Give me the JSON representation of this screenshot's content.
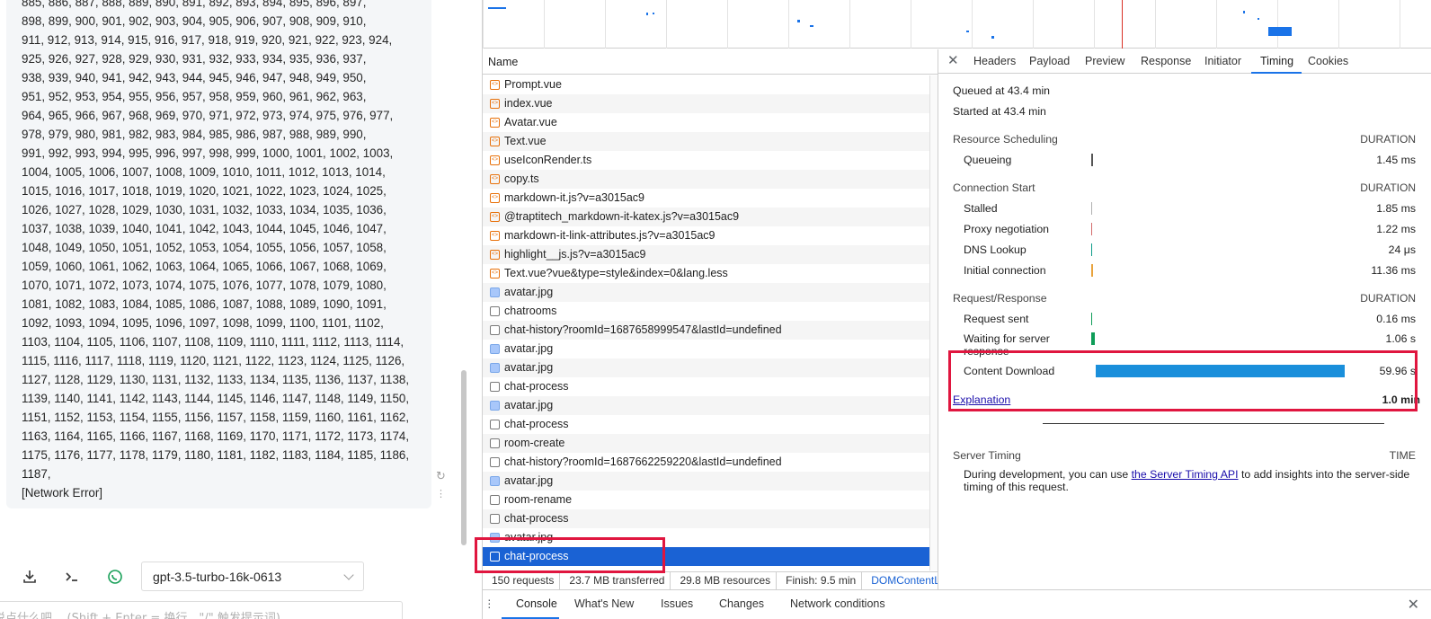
{
  "chat": {
    "message_text": "885, 886, 887, 888, 889, 890, 891, 892, 893, 894, 895, 896, 897,\n898, 899, 900, 901, 902, 903, 904, 905, 906, 907, 908, 909, 910,\n911, 912, 913, 914, 915, 916, 917, 918, 919, 920, 921, 922, 923, 924,\n925, 926, 927, 928, 929, 930, 931, 932, 933, 934, 935, 936, 937,\n938, 939, 940, 941, 942, 943, 944, 945, 946, 947, 948, 949, 950,\n951, 952, 953, 954, 955, 956, 957, 958, 959, 960, 961, 962, 963,\n964, 965, 966, 967, 968, 969, 970, 971, 972, 973, 974, 975, 976, 977,\n978, 979, 980, 981, 982, 983, 984, 985, 986, 987, 988, 989, 990,\n991, 992, 993, 994, 995, 996, 997, 998, 999, 1000, 1001, 1002, 1003,\n1004, 1005, 1006, 1007, 1008, 1009, 1010, 1011, 1012, 1013, 1014,\n1015, 1016, 1017, 1018, 1019, 1020, 1021, 1022, 1023, 1024, 1025,\n1026, 1027, 1028, 1029, 1030, 1031, 1032, 1033, 1034, 1035, 1036,\n1037, 1038, 1039, 1040, 1041, 1042, 1043, 1044, 1045, 1046, 1047,\n1048, 1049, 1050, 1051, 1052, 1053, 1054, 1055, 1056, 1057, 1058,\n1059, 1060, 1061, 1062, 1063, 1064, 1065, 1066, 1067, 1068, 1069,\n1070, 1071, 1072, 1073, 1074, 1075, 1076, 1077, 1078, 1079, 1080,\n1081, 1082, 1083, 1084, 1085, 1086, 1087, 1088, 1089, 1090, 1091,\n1092, 1093, 1094, 1095, 1096, 1097, 1098, 1099, 1100, 1101, 1102,\n1103, 1104, 1105, 1106, 1107, 1108, 1109, 1110, 1111, 1112, 1113, 1114,\n1115, 1116, 1117, 1118, 1119, 1120, 1121, 1122, 1123, 1124, 1125, 1126,\n1127, 1128, 1129, 1130, 1131, 1132, 1133, 1134, 1135, 1136, 1137, 1138,\n1139, 1140, 1141, 1142, 1143, 1144, 1145, 1146, 1147, 1148, 1149, 1150,\n1151, 1152, 1153, 1154, 1155, 1156, 1157, 1158, 1159, 1160, 1161, 1162,\n1163, 1164, 1165, 1166, 1167, 1168, 1169, 1170, 1171, 1172, 1173, 1174,\n1175, 1176, 1177, 1178, 1179, 1180, 1181, 1182, 1183, 1184, 1185, 1186,\n1187,\n[Network Error]",
    "model_select_value": "gpt-3.5-turbo-16k-0613",
    "input_placeholder": "说点什么吧... (Shift + Enter = 换行，\"/\" 触发提示词)",
    "icons": [
      "download-icon",
      "terminal-icon",
      "whatsapp-icon",
      "refresh-icon",
      "more-icon"
    ]
  },
  "network": {
    "name_header": "Name",
    "requests": [
      {
        "name": "Prompt.vue",
        "type": "script"
      },
      {
        "name": "index.vue",
        "type": "script"
      },
      {
        "name": "Avatar.vue",
        "type": "script"
      },
      {
        "name": "Text.vue",
        "type": "script"
      },
      {
        "name": "useIconRender.ts",
        "type": "script"
      },
      {
        "name": "copy.ts",
        "type": "script"
      },
      {
        "name": "markdown-it.js?v=a3015ac9",
        "type": "script"
      },
      {
        "name": "@traptitech_markdown-it-katex.js?v=a3015ac9",
        "type": "script"
      },
      {
        "name": "markdown-it-link-attributes.js?v=a3015ac9",
        "type": "script"
      },
      {
        "name": "highlight__js.js?v=a3015ac9",
        "type": "script"
      },
      {
        "name": "Text.vue?vue&type=style&index=0&lang.less",
        "type": "script"
      },
      {
        "name": "avatar.jpg",
        "type": "img"
      },
      {
        "name": "chatrooms",
        "type": "doc"
      },
      {
        "name": "chat-history?roomId=1687658999547&lastId=undefined",
        "type": "doc"
      },
      {
        "name": "avatar.jpg",
        "type": "img"
      },
      {
        "name": "avatar.jpg",
        "type": "img"
      },
      {
        "name": "chat-process",
        "type": "doc"
      },
      {
        "name": "avatar.jpg",
        "type": "img"
      },
      {
        "name": "chat-process",
        "type": "doc"
      },
      {
        "name": "room-create",
        "type": "doc"
      },
      {
        "name": "chat-history?roomId=1687662259220&lastId=undefined",
        "type": "doc"
      },
      {
        "name": "avatar.jpg",
        "type": "img"
      },
      {
        "name": "room-rename",
        "type": "doc"
      },
      {
        "name": "chat-process",
        "type": "doc"
      },
      {
        "name": "avatar.jpg",
        "type": "img"
      },
      {
        "name": "chat-process",
        "type": "doc",
        "selected": true
      }
    ],
    "status": {
      "requests": "150 requests",
      "transferred": "23.7 MB transferred",
      "resources": "29.8 MB resources",
      "finish": "Finish: 9.5 min",
      "dom": "DOMContentLoaded"
    },
    "tabs": [
      "Headers",
      "Payload",
      "Preview",
      "Response",
      "Initiator",
      "Timing",
      "Cookies"
    ],
    "active_tab": "Timing",
    "timing": {
      "queued": "Queued at 43.4 min",
      "started": "Started at 43.4 min",
      "scheduling_title": "Resource Scheduling",
      "connection_title": "Connection Start",
      "request_title": "Request/Response",
      "duration_label": "DURATION",
      "queueing": {
        "label": "Queueing",
        "value": "1.45 ms"
      },
      "stalled": {
        "label": "Stalled",
        "value": "1.85 ms"
      },
      "proxy": {
        "label": "Proxy negotiation",
        "value": "1.22 ms"
      },
      "dns": {
        "label": "DNS Lookup",
        "value": "24 μs"
      },
      "initial": {
        "label": "Initial connection",
        "value": "11.36 ms"
      },
      "sent": {
        "label": "Request sent",
        "value": "0.16 ms"
      },
      "waiting": {
        "label": "Waiting for server response",
        "value": "1.06 s"
      },
      "download": {
        "label": "Content Download",
        "value": "59.96 s"
      },
      "explanation": "Explanation",
      "total": "1.0 min",
      "server_timing_title": "Server Timing",
      "time_label": "TIME",
      "server_text_before": "During development, you can use ",
      "server_link": "the Server Timing API",
      "server_text_after": " to add insights into the server-side timing of this request."
    },
    "colors": {
      "download_bar": "#1a8fdb",
      "waiting_bar": "#0f9d58",
      "highlight": "#e0163f",
      "selected_row": "#1a62d4"
    }
  },
  "drawer": {
    "tabs": [
      "Console",
      "What's New",
      "Issues",
      "Changes",
      "Network conditions"
    ],
    "active": "Console"
  }
}
